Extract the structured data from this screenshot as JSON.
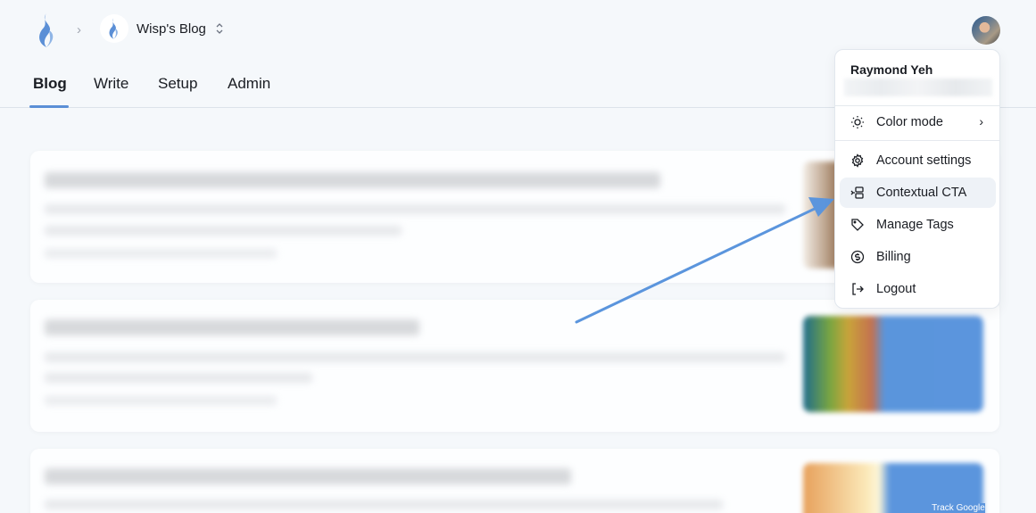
{
  "header": {
    "logo_icon": "flame-logo-icon",
    "breadcrumb_separator_icon": "chevron-right-icon",
    "blog_name": "Wisp's Blog",
    "blog_switch_icon": "chevron-up-down-icon",
    "user_avatar": "user-avatar-photo"
  },
  "tabs": [
    {
      "label": "Blog",
      "active": true
    },
    {
      "label": "Write",
      "active": false
    },
    {
      "label": "Setup",
      "active": false
    },
    {
      "label": "Admin",
      "active": false
    }
  ],
  "posts": [
    {
      "title": "(blurred)",
      "excerpt": "(blurred)",
      "meta": "(blurred)"
    },
    {
      "title": "(blurred)",
      "excerpt": "(blurred)",
      "meta": "(blurred)"
    },
    {
      "title": "(blurred)",
      "excerpt": "(blurred)",
      "meta": "(blurred)",
      "thumbnail_caption": "Track Google"
    }
  ],
  "user_menu": {
    "name": "Raymond Yeh",
    "email": "(blurred)",
    "items": [
      {
        "label": "Color mode",
        "icon": "sun-icon",
        "submenu": true
      },
      {
        "label": "Account settings",
        "icon": "gear-icon"
      },
      {
        "label": "Contextual CTA",
        "icon": "cta-layout-icon",
        "highlighted": true
      },
      {
        "label": "Manage Tags",
        "icon": "tag-icon"
      },
      {
        "label": "Billing",
        "icon": "dollar-circle-icon"
      },
      {
        "label": "Logout",
        "icon": "logout-icon"
      }
    ]
  },
  "annotation": {
    "type": "arrow",
    "color": "#5b95dd",
    "points_to": "Contextual CTA"
  }
}
